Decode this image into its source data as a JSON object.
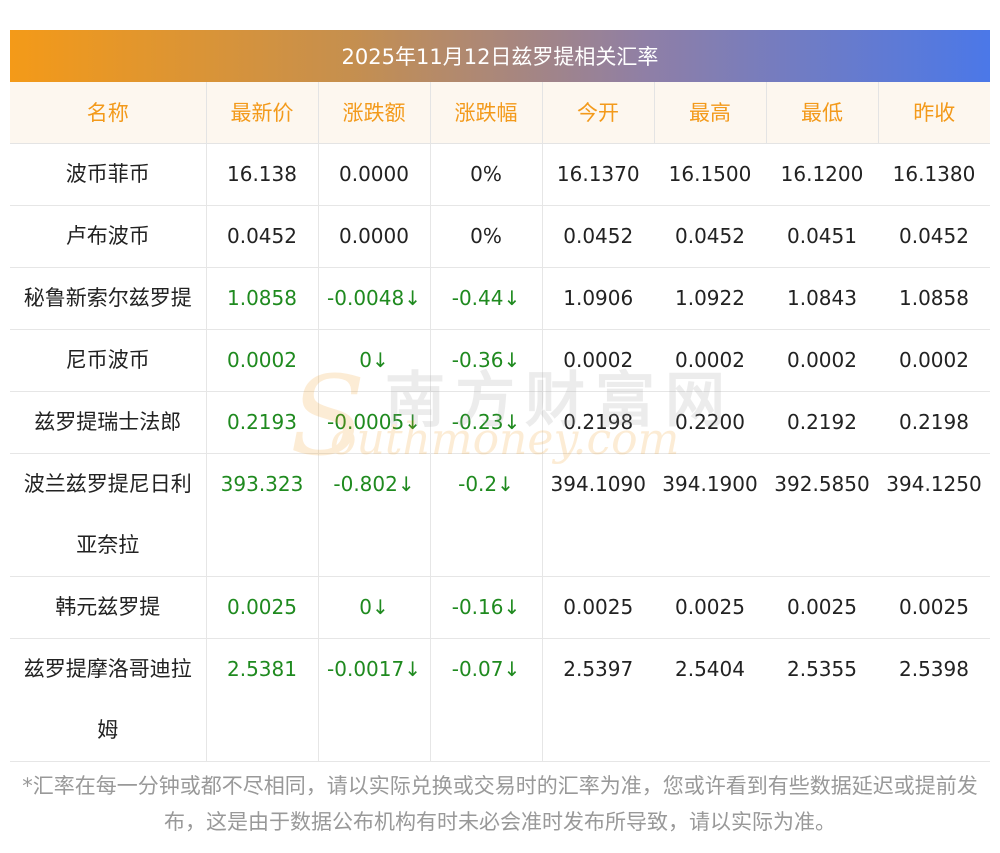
{
  "title": "2025年11月12日兹罗提相关汇率",
  "headers": [
    "名称",
    "最新价",
    "涨跌额",
    "涨跌幅",
    "今开",
    "最高",
    "最低",
    "昨收"
  ],
  "rows": [
    {
      "name": "波币菲币",
      "latest": "16.138",
      "change": "0.0000",
      "pct": "0%",
      "open": "16.1370",
      "high": "16.1500",
      "low": "16.1200",
      "prev": "16.1380"
    },
    {
      "name": "卢布波币",
      "latest": "0.0452",
      "change": "0.0000",
      "pct": "0%",
      "open": "0.0452",
      "high": "0.0452",
      "low": "0.0451",
      "prev": "0.0452"
    },
    {
      "name": "秘鲁新索尔兹罗提",
      "latest": "1.0858",
      "change": "-0.0048↓",
      "pct": "-0.44↓",
      "open": "1.0906",
      "high": "1.0922",
      "low": "1.0843",
      "prev": "1.0858"
    },
    {
      "name": "尼币波币",
      "latest": "0.0002",
      "change": "0↓",
      "pct": "-0.36↓",
      "open": "0.0002",
      "high": "0.0002",
      "low": "0.0002",
      "prev": "0.0002"
    },
    {
      "name": "兹罗提瑞士法郎",
      "latest": "0.2193",
      "change": "-0.0005↓",
      "pct": "-0.23↓",
      "open": "0.2198",
      "high": "0.2200",
      "low": "0.2192",
      "prev": "0.2198"
    },
    {
      "name": "波兰兹罗提尼日利亚奈拉",
      "latest": "393.323",
      "change": "-0.802↓",
      "pct": "-0.2↓",
      "open": "394.1090",
      "high": "394.1900",
      "low": "392.5850",
      "prev": "394.1250"
    },
    {
      "name": "韩元兹罗提",
      "latest": "0.0025",
      "change": "0↓",
      "pct": "-0.16↓",
      "open": "0.0025",
      "high": "0.0025",
      "low": "0.0025",
      "prev": "0.0025"
    },
    {
      "name": "兹罗提摩洛哥迪拉姆",
      "latest": "2.5381",
      "change": "-0.0017↓",
      "pct": "-0.07↓",
      "open": "2.5397",
      "high": "2.5404",
      "low": "2.5355",
      "prev": "2.5398"
    }
  ],
  "watermark": {
    "cn": "南方财富网",
    "en": "outhmoney.com",
    "s": "S"
  },
  "note": "*汇率在每一分钟或都不尽相同，请以实际兑换或交易时的汇率为准，您或许看到有些数据延迟或提前发布，这是由于数据公布机构有时未必会准时发布所导致，请以实际为准。",
  "colors": {
    "header_text": "#f39a1b",
    "down": "#1f8a1f",
    "gradient_start": "#f49a18",
    "gradient_end": "#4b78e8"
  }
}
